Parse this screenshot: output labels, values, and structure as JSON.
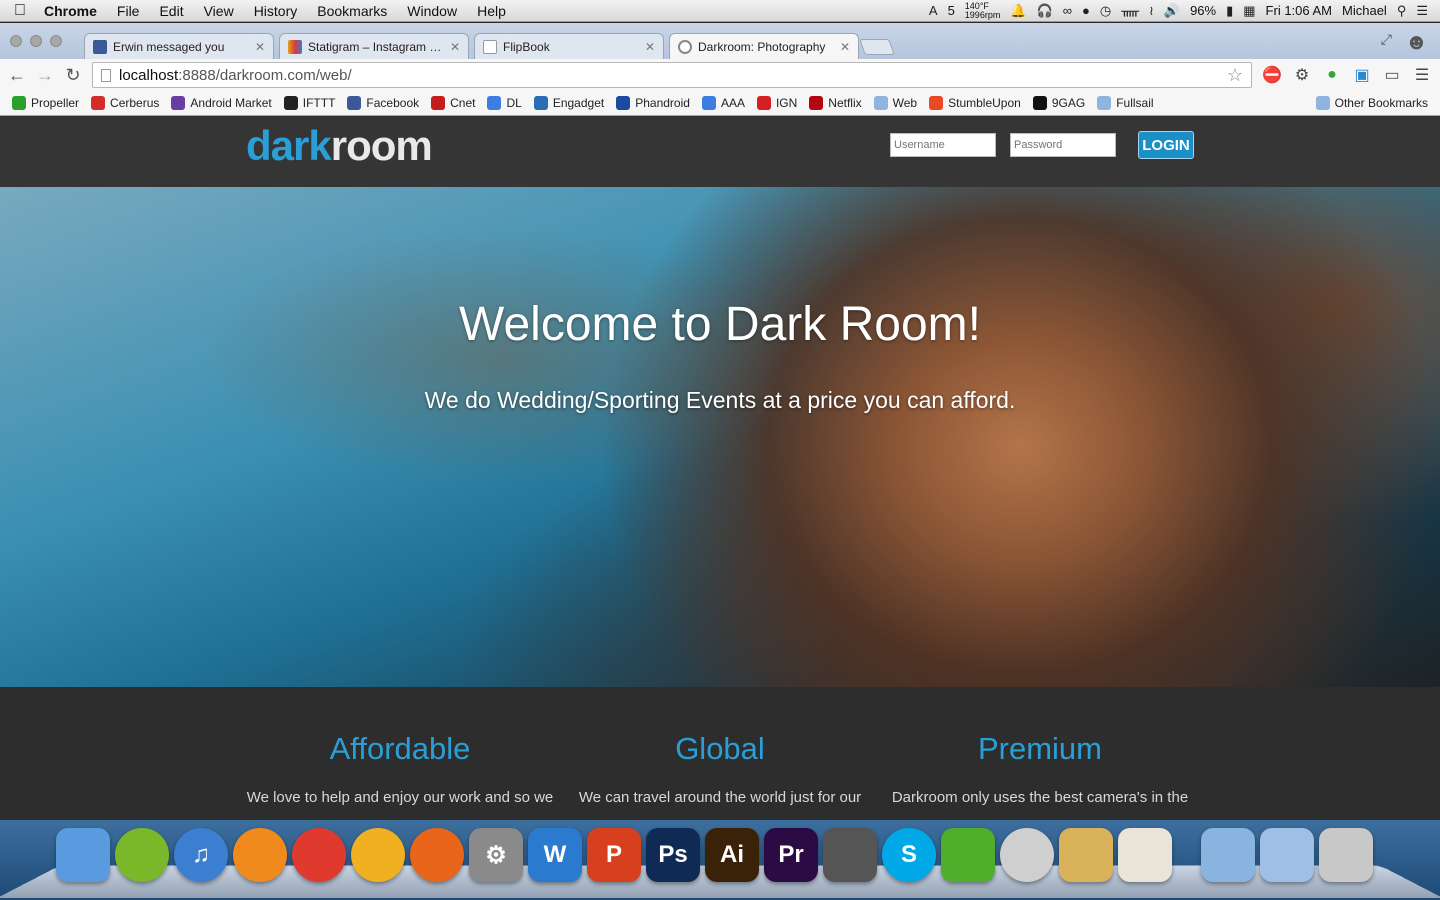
{
  "menubar": {
    "app_name": "Chrome",
    "items": [
      "File",
      "Edit",
      "View",
      "History",
      "Bookmarks",
      "Window",
      "Help"
    ],
    "status": {
      "adobe_count": "5",
      "temp": "140°F",
      "rpm": "1996rpm",
      "battery": "96%",
      "clock": "Fri 1:06 AM",
      "user": "Michael"
    }
  },
  "tabs": [
    {
      "title": "Erwin messaged you",
      "icon": "facebook-icon",
      "color": "#3b5998"
    },
    {
      "title": "Statigram – Instagram web",
      "icon": "statigram-icon",
      "color": "#e0a020"
    },
    {
      "title": "FlipBook",
      "icon": "page-icon",
      "color": "#ffffff"
    },
    {
      "title": "Darkroom: Photography",
      "icon": "loading-icon",
      "color": "#888888"
    }
  ],
  "toolbar": {
    "url_host": "localhost",
    "url_path": ":8888/darkroom.com/web/"
  },
  "bookmarks": [
    {
      "label": "Propeller",
      "color": "#2aa22a"
    },
    {
      "label": "Cerberus",
      "color": "#d62b2b"
    },
    {
      "label": "Android Market",
      "color": "#6a3ea1"
    },
    {
      "label": "IFTTT",
      "color": "#222222"
    },
    {
      "label": "Facebook",
      "color": "#3b5998"
    },
    {
      "label": "Cnet",
      "color": "#c41d1d"
    },
    {
      "label": "DL",
      "color": "#3b7de0"
    },
    {
      "label": "Engadget",
      "color": "#2a6cb5"
    },
    {
      "label": "Phandroid",
      "color": "#1c4aa0"
    },
    {
      "label": "AAA",
      "color": "#3b7de0"
    },
    {
      "label": "IGN",
      "color": "#d42020"
    },
    {
      "label": "Netflix",
      "color": "#b20710"
    },
    {
      "label": "Web",
      "color": "#8fb4dd"
    },
    {
      "label": "StumbleUpon",
      "color": "#eb4924"
    },
    {
      "label": "9GAG",
      "color": "#111111"
    },
    {
      "label": "Fullsail",
      "color": "#8fb4dd"
    }
  ],
  "other_bookmarks": "Other Bookmarks",
  "site": {
    "logo_part1": "dark",
    "logo_part2": "room",
    "username_placeholder": "Username",
    "password_placeholder": "Password",
    "login_label": "LOGIN",
    "accent_color": "#2a9fd6"
  },
  "hero": {
    "title": "Welcome to Dark Room!",
    "subtitle": "We do Wedding/Sporting Events at a price you can afford."
  },
  "features": [
    {
      "title": "Affordable",
      "text": "We love to help and enjoy our work and so we"
    },
    {
      "title": "Global",
      "text": "We can travel around the world just for our"
    },
    {
      "title": "Premium",
      "text": "Darkroom only uses the best camera's in the"
    }
  ],
  "dock": [
    {
      "name": "finder",
      "label": "",
      "color": "#5a9be0"
    },
    {
      "name": "spotify",
      "label": "",
      "color": "#7ab829"
    },
    {
      "name": "itunes",
      "label": "♫",
      "color": "#3a7fd0"
    },
    {
      "name": "ibooks",
      "label": "",
      "color": "#f08a1c"
    },
    {
      "name": "chrome",
      "label": "",
      "color": "#e03a2e"
    },
    {
      "name": "chrome-canary",
      "label": "",
      "color": "#f0b020"
    },
    {
      "name": "firefox",
      "label": "",
      "color": "#e8651a"
    },
    {
      "name": "system-preferences",
      "label": "⚙",
      "color": "#8a8a8a"
    },
    {
      "name": "word",
      "label": "W",
      "color": "#2a7ad0"
    },
    {
      "name": "powerpoint",
      "label": "P",
      "color": "#d6401e"
    },
    {
      "name": "photoshop",
      "label": "Ps",
      "color": "#0f2a55"
    },
    {
      "name": "illustrator",
      "label": "Ai",
      "color": "#3a2208"
    },
    {
      "name": "premiere",
      "label": "Pr",
      "color": "#2c0a44"
    },
    {
      "name": "github",
      "label": "",
      "color": "#555555"
    },
    {
      "name": "skype",
      "label": "S",
      "color": "#00a8e8"
    },
    {
      "name": "leaf",
      "label": "",
      "color": "#4fae2a"
    },
    {
      "name": "sequel-pro",
      "label": "",
      "color": "#cfcfcf"
    },
    {
      "name": "database",
      "label": "",
      "color": "#d9b25a"
    },
    {
      "name": "maps",
      "label": "",
      "color": "#e8e4d8"
    },
    {
      "name": "applications-folder",
      "label": "",
      "color": "#8ab4e0"
    },
    {
      "name": "downloads-folder",
      "label": "",
      "color": "#9ec0e4"
    },
    {
      "name": "trash",
      "label": "",
      "color": "#c8c8c8"
    }
  ]
}
